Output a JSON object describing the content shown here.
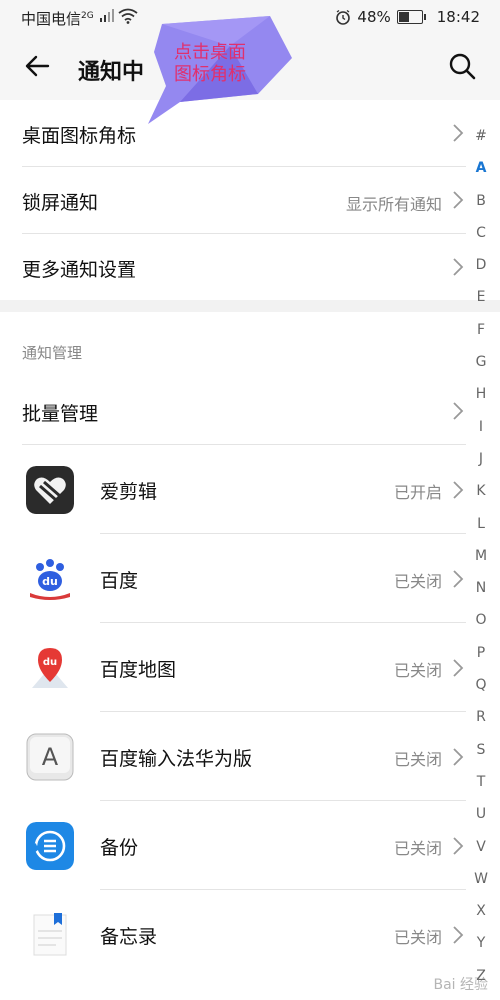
{
  "status_bar": {
    "carrier": "中国电信",
    "network": "2G",
    "battery_percent": "48%",
    "battery_level": 0.48,
    "time": "18:42"
  },
  "app_bar": {
    "title": "通知中",
    "back_icon": "back-arrow-icon",
    "search_icon": "search-icon"
  },
  "annotation": {
    "text_line1": "点击桌面",
    "text_line2": "图标角标",
    "color": "#8a7cf0"
  },
  "settings": [
    {
      "label": "桌面图标角标",
      "value": ""
    },
    {
      "label": "锁屏通知",
      "value": "显示所有通知"
    },
    {
      "label": "更多通知设置",
      "value": ""
    }
  ],
  "section": {
    "header": "通知管理",
    "batch_label": "批量管理"
  },
  "apps": [
    {
      "name": "爱剪辑",
      "status": "已开启",
      "icon": "aijianji-icon"
    },
    {
      "name": "百度",
      "status": "已关闭",
      "icon": "baidu-paw-icon"
    },
    {
      "name": "百度地图",
      "status": "已关闭",
      "icon": "baidu-map-icon"
    },
    {
      "name": "百度输入法华为版",
      "status": "已关闭",
      "icon": "baidu-input-icon"
    },
    {
      "name": "备份",
      "status": "已关闭",
      "icon": "backup-icon"
    },
    {
      "name": "备忘录",
      "status": "已关闭",
      "icon": "notepad-icon"
    }
  ],
  "index_letters": [
    "#",
    "A",
    "B",
    "C",
    "D",
    "E",
    "F",
    "G",
    "H",
    "I",
    "J",
    "K",
    "L",
    "M",
    "N",
    "O",
    "P",
    "Q",
    "R",
    "S",
    "T",
    "U",
    "V",
    "W",
    "X",
    "Y",
    "Z"
  ],
  "active_letter": "A",
  "colors": {
    "accent": "#1976d2",
    "annotation_text": "#e0306e"
  },
  "watermark": "Bai 经验"
}
